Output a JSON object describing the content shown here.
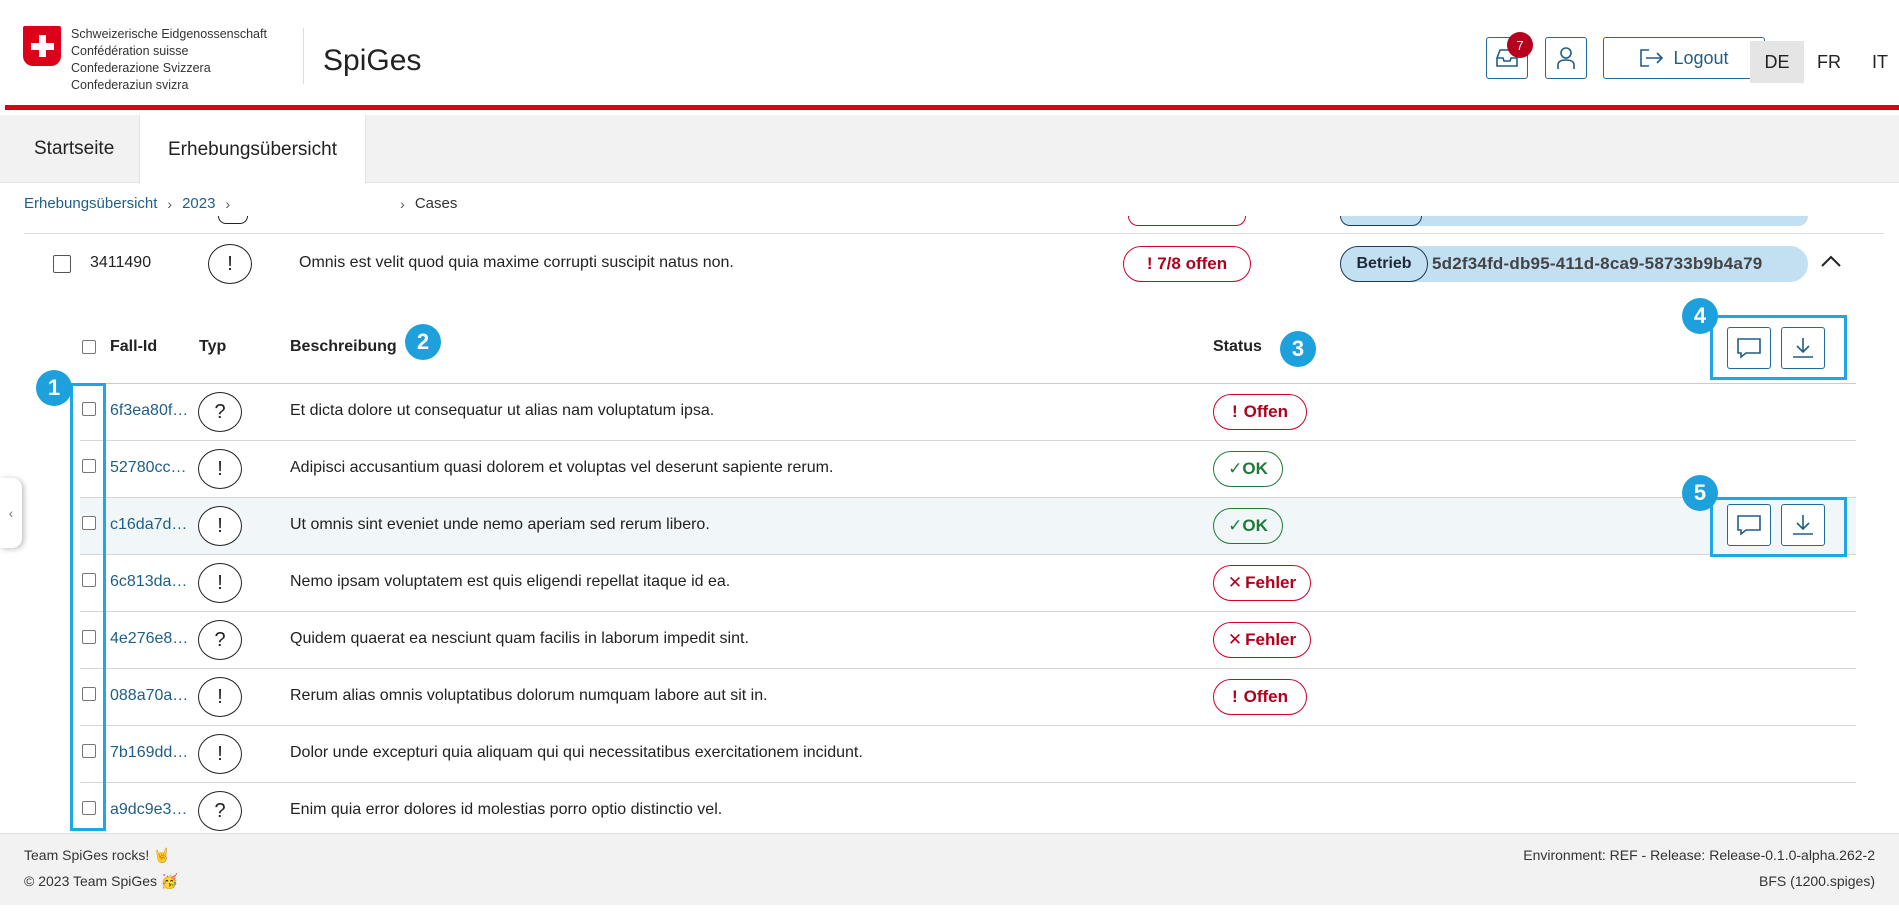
{
  "header": {
    "logo_lines": [
      "Schweizerische Eidgenossenschaft",
      "Confédération suisse",
      "Confederazione Svizzera",
      "Confederaziun svizra"
    ],
    "app_title": "SpiGes",
    "inbox_count": "7",
    "logout_label": "Logout",
    "languages": [
      "DE",
      "FR",
      "IT"
    ],
    "active_language": "DE"
  },
  "tabs": [
    {
      "label": "Startseite",
      "active": false
    },
    {
      "label": "Erhebungsübersicht",
      "active": true
    }
  ],
  "breadcrumb": {
    "items": [
      "Erhebungsübersicht",
      "2023",
      "Cases"
    ]
  },
  "parent_row": {
    "id": "3411490",
    "type_symbol": "!",
    "description": "Omnis est velit quod quia maxime corrupti suscipit natus non.",
    "status": "! 7/8 offen",
    "betrieb_label": "Betrieb",
    "betrieb_id": "5d2f34fd-db95-411d-8ca9-58733b9b4a79"
  },
  "table": {
    "headers": {
      "fall_id": "Fall-Id",
      "typ": "Typ",
      "beschreibung": "Beschreibung",
      "status": "Status"
    },
    "rows": [
      {
        "fall_id": "6f3ea80f…",
        "typ": "?",
        "beschreibung": "Et dicta dolore ut consequatur ut alias nam voluptatum ipsa.",
        "status": "Offen",
        "status_kind": "offen"
      },
      {
        "fall_id": "52780cc…",
        "typ": "!",
        "beschreibung": "Adipisci accusantium quasi dolorem et voluptas vel deserunt sapiente rerum.",
        "status": "OK",
        "status_kind": "ok"
      },
      {
        "fall_id": "c16da7d…",
        "typ": "!",
        "beschreibung": "Ut omnis sint eveniet unde nemo aperiam sed rerum libero.",
        "status": "OK",
        "status_kind": "ok"
      },
      {
        "fall_id": "6c813da…",
        "typ": "!",
        "beschreibung": "Nemo ipsam voluptatem est quis eligendi repellat itaque id ea.",
        "status": "Fehler",
        "status_kind": "fehler"
      },
      {
        "fall_id": "4e276e8…",
        "typ": "?",
        "beschreibung": "Quidem quaerat ea nesciunt quam facilis in laborum impedit sint.",
        "status": "Fehler",
        "status_kind": "fehler"
      },
      {
        "fall_id": "088a70a…",
        "typ": "!",
        "beschreibung": "Rerum alias omnis voluptatibus dolorum numquam labore aut sit in.",
        "status": "Offen",
        "status_kind": "offen"
      },
      {
        "fall_id": "7b169dd…",
        "typ": "!",
        "beschreibung": "Dolor unde excepturi quia aliquam qui qui necessitatibus exercitationem incidunt.",
        "status": "",
        "status_kind": "none"
      },
      {
        "fall_id": "a9dc9e3…",
        "typ": "?",
        "beschreibung": "Enim quia error dolores id molestias porro optio distinctio vel.",
        "status": "",
        "status_kind": "none"
      }
    ]
  },
  "markers": [
    "1",
    "2",
    "3",
    "4",
    "5"
  ],
  "footer": {
    "left_line1": "Team SpiGes rocks! 🤘",
    "left_line2": "© 2023 Team SpiGes 🥳",
    "right_line1": "Environment: REF - Release: Release-0.1.0-alpha.262-2",
    "right_line2": "BFS (1200.spiges)"
  },
  "colors": {
    "accent": "#1f5e86",
    "swiss_red": "#dc0018",
    "highlight": "#1ea7e6",
    "error": "#b0001d",
    "ok": "#1f7a3a"
  }
}
